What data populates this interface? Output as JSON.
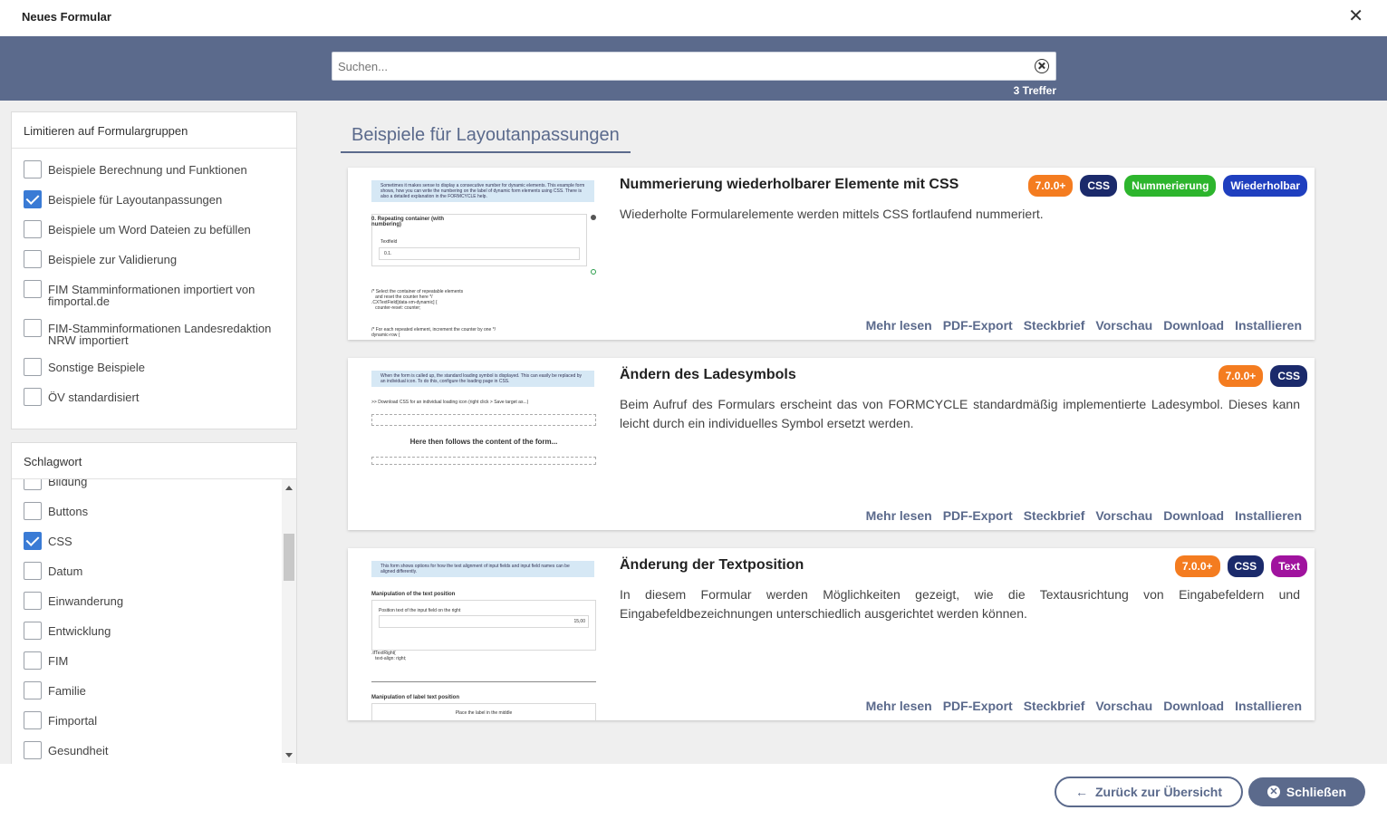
{
  "window": {
    "title": "Neues Formular",
    "close_symbol": "✕"
  },
  "search": {
    "placeholder": "Suchen...",
    "value": "",
    "hits": "3 Treffer"
  },
  "filters": {
    "groups_title": "Limitieren auf Formulargruppen",
    "groups": [
      {
        "label": "Beispiele Berechnung und Funktionen",
        "checked": false
      },
      {
        "label": "Beispiele für Layoutanpassungen",
        "checked": true
      },
      {
        "label": "Beispiele um Word Dateien zu befüllen",
        "checked": false
      },
      {
        "label": "Beispiele zur Validierung",
        "checked": false
      },
      {
        "label": "FIM Stamminformationen importiert von fimportal.de",
        "checked": false
      },
      {
        "label": "FIM-Stamminformationen Landesredaktion NRW importiert",
        "checked": false
      },
      {
        "label": "Sonstige Beispiele",
        "checked": false
      },
      {
        "label": "ÖV standardisiert",
        "checked": false
      }
    ],
    "tags_title": "Schlagwort",
    "tags": [
      {
        "label": "Bildung",
        "checked": false
      },
      {
        "label": "Buttons",
        "checked": false
      },
      {
        "label": "CSS",
        "checked": true
      },
      {
        "label": "Datum",
        "checked": false
      },
      {
        "label": "Einwanderung",
        "checked": false
      },
      {
        "label": "Entwicklung",
        "checked": false
      },
      {
        "label": "FIM",
        "checked": false
      },
      {
        "label": "Familie",
        "checked": false
      },
      {
        "label": "Fimportal",
        "checked": false
      },
      {
        "label": "Gesundheit",
        "checked": false
      }
    ]
  },
  "main": {
    "group_heading": "Beispiele für Layoutanpassungen",
    "actions": [
      "Mehr lesen",
      "PDF-Export",
      "Steckbrief",
      "Vorschau",
      "Download",
      "Installieren"
    ],
    "cards": [
      {
        "title": "Nummerierung wiederholbarer Elemente mit CSS",
        "description": "Wiederholte Formularelemente werden mittels CSS fortlaufend nummeriert.",
        "badges": [
          {
            "label": "7.0.0+",
            "color": "#f47c20"
          },
          {
            "label": "CSS",
            "color": "#1b2a6b"
          },
          {
            "label": "Nummerierung",
            "color": "#2db52d"
          },
          {
            "label": "Wiederholbar",
            "color": "#1f3fbf"
          }
        ],
        "thumb": {
          "info": "Sometimes it makes sense to display a consecutive number for dynamic elements. This example form shows, how you can write the numbering on the label of dynamic form elements using CSS. There is also a detailed explanation in the FORMCYCLE help.",
          "heading": "0. Repeating container (with numbering)",
          "field_label": "Textfield",
          "field_value": "0.1.",
          "code1": "/* Select the container of repeatable elements\n   and reset the counter here */\n.CXTextField[data-xm-dynamic] {\n   counter-reset: counter;",
          "code2": "/* For each repeated element, increment the counter by one */\ndynamic-row {"
        }
      },
      {
        "title": "Ändern des Ladesymbols",
        "description": "Beim Aufruf des Formulars erscheint das von FORMCYCLE standardmäßig implementierte Ladesymbol. Dieses kann leicht durch ein individuelles Symbol ersetzt werden.",
        "badges": [
          {
            "label": "7.0.0+",
            "color": "#f47c20"
          },
          {
            "label": "CSS",
            "color": "#1b2a6b"
          }
        ],
        "thumb": {
          "info": "When the form is called up, the standard loading symbol is displayed. This can easily be replaced by an individual icon. To do this, configure the loading page in CSS.",
          "link": ">> Download CSS for an individual loading icon (right click > Save target as...)",
          "content": "Here then follows the content of the form..."
        }
      },
      {
        "title": "Änderung der Textposition",
        "description": "In diesem Formular werden Möglichkeiten gezeigt, wie die Textausrichtung von Eingabefeldern und Eingabefeldbezeichnungen unterschiedlich ausgerichtet werden können.",
        "badges": [
          {
            "label": "7.0.0+",
            "color": "#f47c20"
          },
          {
            "label": "CSS",
            "color": "#1b2a6b"
          },
          {
            "label": "Text",
            "color": "#a0139e"
          }
        ],
        "thumb": {
          "info": "This form shows options for how the text alignment of input fields and input field names can be aligned differently.",
          "heading1": "Manipulation of the text position",
          "field_label": "Position text of the input field on the right",
          "field_value": "15,00",
          "code": ".tfTextRight{\n   text-align: right;",
          "heading2": "Manipulation of label text position",
          "label2": "Place the label in the middle"
        }
      }
    ]
  },
  "footer": {
    "back_label": "Zurück zur Übersicht",
    "close_label": "Schließen"
  }
}
